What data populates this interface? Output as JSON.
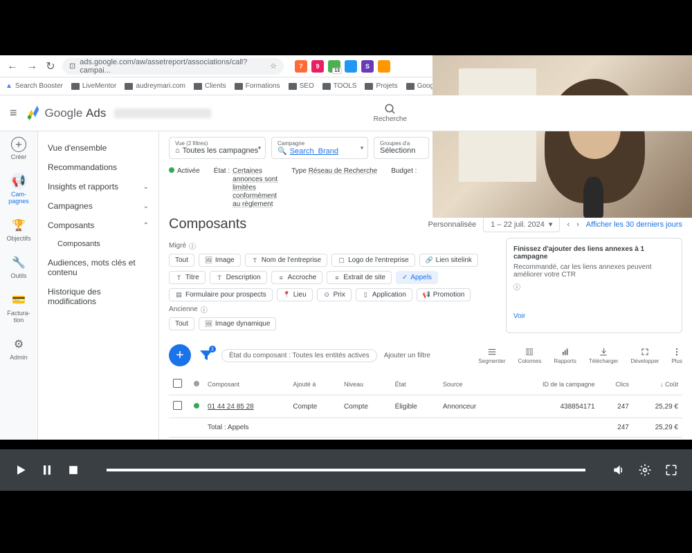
{
  "browser": {
    "url": "ads.google.com/aw/assetreport/associations/call?campai...",
    "bookmarks": [
      "Search Booster",
      "LiveMentor",
      "audreymari.com",
      "Clients",
      "Formations",
      "SEO",
      "TOOLS",
      "Projets",
      "Google Ad"
    ]
  },
  "app": {
    "logo_text_1": "Google",
    "logo_text_2": "Ads",
    "search_label": "Recherche"
  },
  "rail": {
    "create": "Créer",
    "campaigns": "Cam-\npagnes",
    "objectifs": "Objectifs",
    "outils": "Outils",
    "factura": "Factura-\ntion",
    "admin": "Admin"
  },
  "sidebar": {
    "items": [
      "Vue d'ensemble",
      "Recommandations",
      "Insights et rapports",
      "Campagnes",
      "Composants",
      "Composants",
      "Audiences, mots clés et contenu",
      "Historique des modifications"
    ]
  },
  "filters": {
    "vue_label": "Vue (2 filtres)",
    "vue_value": "Toutes les campagnes",
    "campagne_label": "Campagne",
    "campagne_value": "Search_Brand",
    "groupes_label": "Groupes d'a",
    "groupes_value": "Sélectionn"
  },
  "status": {
    "activee": "Activée",
    "etat_label": "État :",
    "etat_lines": [
      "Certaines",
      "annonces sont",
      "limitées",
      "conformément",
      "au règlement"
    ],
    "type_label": "Type",
    "type_value": "Réseau de Recherche",
    "budget_label": "Budget :"
  },
  "page": {
    "title": "Composants",
    "personnalisee": "Personnalisée",
    "date_range": "1 – 22 juil. 2024",
    "last30": "Afficher les 30 derniers jours",
    "migre": "Migré",
    "ancienne": "Ancienne"
  },
  "chips_migre": [
    "Tout",
    "Image",
    "Nom de l'entreprise",
    "Logo de l'entreprise",
    "Lien sitelink",
    "Titre",
    "Description",
    "Accroche",
    "Extrait de site",
    "Appels",
    "Formulaire pour prospects",
    "Lieu",
    "Prix",
    "Application",
    "Promotion"
  ],
  "chips_ancienne": [
    "Tout",
    "Image dynamique"
  ],
  "card": {
    "title": "Finissez d'ajouter des liens annexes à 1 campagne",
    "body": "Recommandé, car les liens annexes peuvent améliorer votre CTR",
    "voir": "Voir"
  },
  "toolbar": {
    "filter_status": "État du composant : Toutes les entités actives",
    "add_filter": "Ajouter un filtre",
    "actions": [
      "Segmenter",
      "Colonnes",
      "Rapports",
      "Télécharger",
      "Développer",
      "Plus"
    ]
  },
  "table": {
    "headers": [
      "Composant",
      "Ajouté à",
      "Niveau",
      "État",
      "Source",
      "ID de la campagne",
      "Clics",
      "↓ Coût"
    ],
    "row": {
      "composant": "01 44 24 85 28",
      "ajoute": "Compte",
      "niveau": "Compte",
      "etat": "Éligible",
      "source": "Annonceur",
      "id": "438854171",
      "clics": "247",
      "cout": "25,29 €"
    },
    "total": {
      "label": "Total : Appels",
      "clics": "247",
      "cout": "25,29 €"
    }
  }
}
